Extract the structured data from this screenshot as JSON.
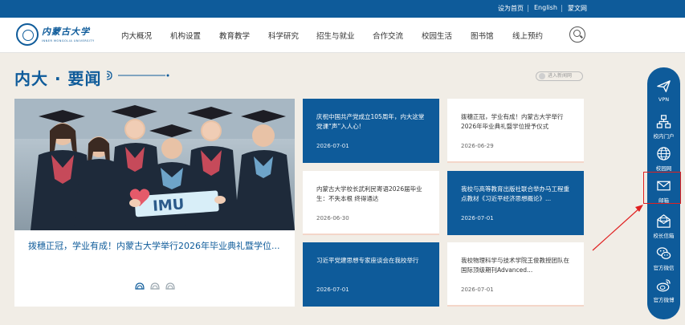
{
  "topbar": {
    "links": [
      "设为首页",
      "English",
      "蒙文网"
    ]
  },
  "header": {
    "logo_cn": "内蒙古大学",
    "logo_en": "INNER MONGOLIA UNIVERSITY",
    "nav": [
      "内大概况",
      "机构设置",
      "教育教学",
      "科学研究",
      "招生与就业",
      "合作交流",
      "校园生活",
      "图书馆",
      "线上预约"
    ],
    "search_icon": "search-icon"
  },
  "section": {
    "title": "内大 · 要闻",
    "more_label": "进入新闻网"
  },
  "featured": {
    "title": "拨穗正冠，学业有成！内蒙古大学举行2026年毕业典礼暨学位...",
    "banner_text": "IMU"
  },
  "news": [
    {
      "title": "庆祝中国共产党成立105周年，内大这堂党课“声”入人心!",
      "date": "2026-07-01",
      "style": "blue"
    },
    {
      "title": "拨穗正冠，学业有成！内蒙古大学举行2026年毕业典礼暨学位授予仪式",
      "date": "2026-06-29",
      "style": "white"
    },
    {
      "title": "内蒙古大学校长武利民寄语2026届毕业生：不失本根 终得通达",
      "date": "2026-06-30",
      "style": "white"
    },
    {
      "title": "我校与高等教育出版社联合举办马工程重点教材《习近平经济思想概论》...",
      "date": "2026-07-01",
      "style": "blue"
    },
    {
      "title": "习近平党建思想专家座谈会在我校举行",
      "date": "2026-07-01",
      "style": "blue"
    },
    {
      "title": "我校物理科学与技术学院王俊教授团队在国际顶级期刊Advanced...",
      "date": "2026-07-01",
      "style": "white"
    }
  ],
  "sidebar": [
    {
      "label": "VPN",
      "icon": "paper-plane-icon"
    },
    {
      "label": "校内门户",
      "icon": "sitemap-icon"
    },
    {
      "label": "校园网",
      "icon": "globe-icon"
    },
    {
      "label": "邮箱",
      "icon": "mail-icon"
    },
    {
      "label": "校长信箱",
      "icon": "mailbox-icon"
    },
    {
      "label": "官方微信",
      "icon": "wechat-icon"
    },
    {
      "label": "官方微博",
      "icon": "weibo-icon"
    }
  ],
  "colors": {
    "primary": "#0e5b9a",
    "background": "#f1ede6",
    "highlight": "#e02020"
  }
}
